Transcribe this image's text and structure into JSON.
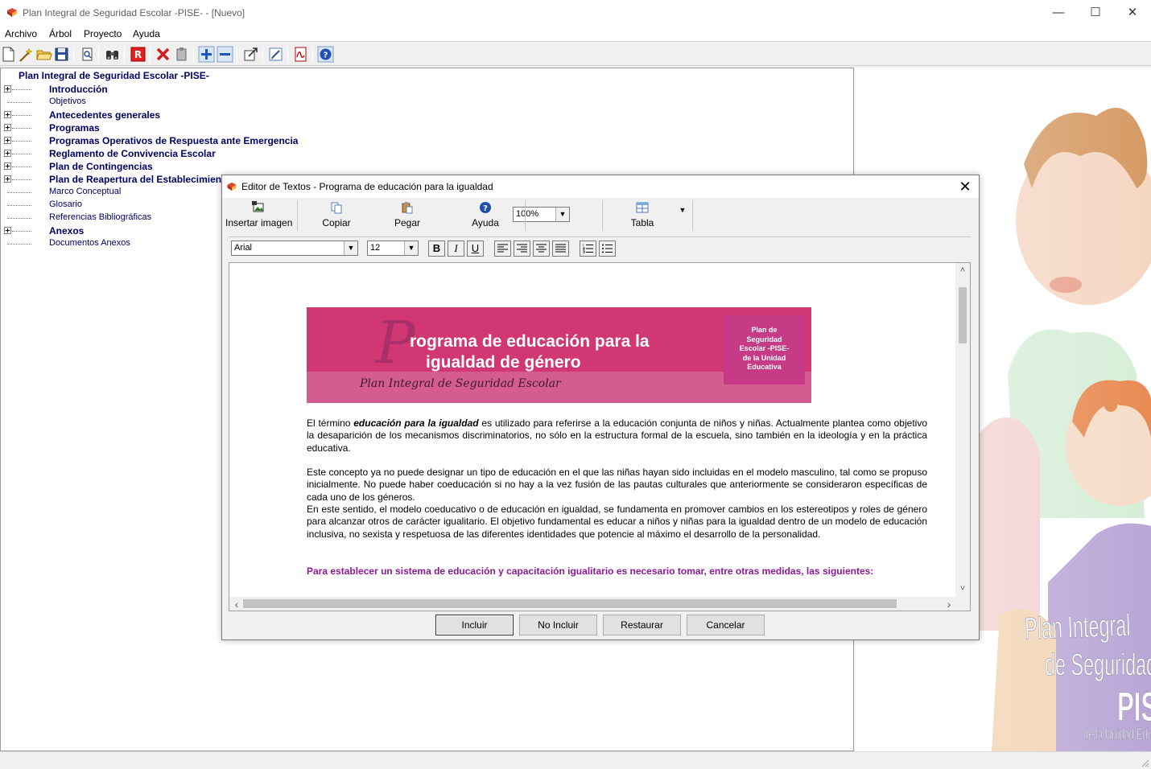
{
  "window": {
    "title": "Plan Integral de Seguridad Escolar -PISE- - [Nuevo]"
  },
  "menu": [
    "Archivo",
    "Árbol",
    "Proyecto",
    "Ayuda"
  ],
  "toolbar_icons": [
    "new-document-icon",
    "edit-wand-icon",
    "open-folder-icon",
    "save-icon",
    "print-preview-icon",
    "binoculars-icon",
    "r-report-icon",
    "delete-icon",
    "clipboard-icon",
    "add-icon",
    "remove-icon",
    "export-icon",
    "edit-note-icon",
    "pdf-icon",
    "help-icon"
  ],
  "tree": {
    "root": "Plan Integral de Seguridad Escolar -PISE-",
    "items": [
      {
        "label": "Introducción",
        "bold": true,
        "expandable": true
      },
      {
        "label": "Objetivos",
        "bold": false,
        "expandable": false
      },
      {
        "label": "Antecedentes generales",
        "bold": true,
        "expandable": true
      },
      {
        "label": "Programas",
        "bold": true,
        "expandable": true
      },
      {
        "label": "Programas Operativos de Respuesta ante Emergencia",
        "bold": true,
        "expandable": true
      },
      {
        "label": "Reglamento de Convivencia Escolar",
        "bold": true,
        "expandable": true
      },
      {
        "label": "Plan de Contingencias",
        "bold": true,
        "expandable": true
      },
      {
        "label": "Plan de Reapertura del Establecimiento",
        "bold": true,
        "expandable": true
      },
      {
        "label": "Marco Conceptual",
        "bold": false,
        "expandable": false
      },
      {
        "label": "Glosario",
        "bold": false,
        "expandable": false
      },
      {
        "label": "Referencias Bibliográficas",
        "bold": false,
        "expandable": false
      },
      {
        "label": "Anexos",
        "bold": true,
        "expandable": true
      },
      {
        "label": "Documentos Anexos",
        "bold": false,
        "expandable": false
      }
    ]
  },
  "background_logo": {
    "line1": "Plan Integral",
    "line2": "de Seguridad Escolar",
    "line3": "PISE",
    "line4": "de la Unidad Educativa"
  },
  "dialog": {
    "title": "Editor de Textos - Programa de educación para la igualdad",
    "toolbar": {
      "insert_image": "Insertar imagen",
      "copy": "Copiar",
      "paste": "Pegar",
      "help": "Ayuda",
      "zoom": "100%",
      "table": "Tabla"
    },
    "format": {
      "font": "Arial",
      "size": "12",
      "bold": "B",
      "italic": "I",
      "underline": "U"
    },
    "banner": {
      "big_letter": "P",
      "title_line1": "rograma de educación para la",
      "title_line2": "igualdad de género",
      "script": "Plan Integral de Seguridad Escolar",
      "badge": [
        "Plan de",
        "Seguridad",
        "Escolar -PISE-",
        "de la Unidad",
        "Educativa"
      ]
    },
    "body": {
      "p1_before": "El término ",
      "p1_em": "educación para la igualdad",
      "p1_after": " es utilizado para referirse a la educación conjunta de niños y niñas. Actualmente plantea como objetivo la desaparición de los mecanismos discriminatorios, no sólo en la estructura formal de la escuela, sino también en la ideología y en la práctica educativa.",
      "p2": "Este concepto ya no puede designar un tipo de educación en el que las niñas hayan sido incluidas en el modelo masculino, tal como se propuso inicialmente. No puede haber coeducación si no hay a la vez fusión de las pautas culturales que anteriormente se consideraron específicas de cada uno de los géneros.",
      "p3": "En este sentido, el modelo coeducativo o de educación en igualdad, se fundamenta en promover cambios en los estereotipos y roles de género para alcanzar otros de carácter igualitario. El objetivo fundamental es educar a niños y niñas para la igualdad dentro de un modelo de educación inclusiva, no sexista y respetuosa de las diferentes identidades que potencie al máximo el desarrollo de la personalidad.",
      "p4": "Para establecer un sistema de educación y capacitación igualitario es necesario tomar, entre otras medidas, las siguientes:"
    },
    "buttons": {
      "include": "Incluir",
      "exclude": "No Incluir",
      "restore": "Restaurar",
      "cancel": "Cancelar"
    }
  },
  "colors": {
    "tree_text": "#000064",
    "banner_pink": "#d13772",
    "banner_light": "#d45c90",
    "badge": "#c73a85",
    "violet_text": "#8b1a94"
  }
}
